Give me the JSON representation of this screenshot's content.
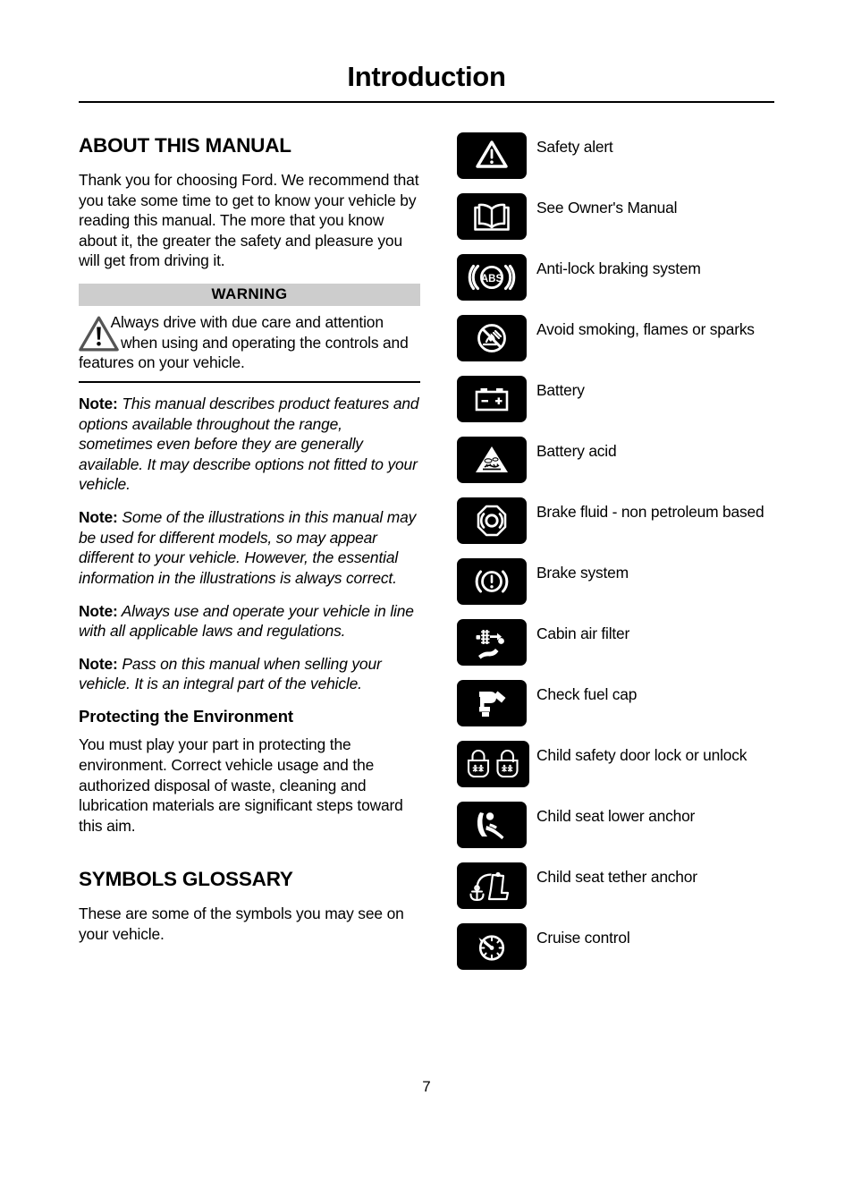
{
  "page": {
    "title": "Introduction",
    "number": "7"
  },
  "left_column": {
    "about": {
      "heading": "ABOUT THIS MANUAL",
      "intro": "Thank you for choosing Ford. We recommend that you take some time to get to know your vehicle by reading this manual. The more that you know about it, the greater the safety and pleasure you will get from driving it.",
      "warning": {
        "bar_label": "WARNING",
        "text": "Always drive with due care and attention when using and operating the controls and features on your vehicle.",
        "icon": "warning-triangle-icon"
      },
      "notes": [
        {
          "label": "Note:",
          "text": " This manual describes product features and options available throughout the range, sometimes even before they are generally available. It may describe options not fitted to your vehicle."
        },
        {
          "label": "Note:",
          "text": " Some of the illustrations in this manual may be used for different models, so may appear different to your vehicle. However, the essential information in the illustrations is always correct."
        },
        {
          "label": "Note:",
          "text": " Always use and operate your vehicle in line with all applicable laws and regulations."
        },
        {
          "label": "Note:",
          "text": " Pass on this manual when selling your vehicle. It is an integral part of the vehicle."
        }
      ]
    },
    "environment": {
      "heading": "Protecting the Environment",
      "text": "You must play your part in protecting the environment. Correct vehicle usage and the authorized disposal of waste, cleaning and lubrication materials are significant steps toward this aim."
    },
    "glossary": {
      "heading": "SYMBOLS GLOSSARY",
      "text": "These are some of the symbols you may see on your vehicle."
    }
  },
  "right_column": {
    "symbols": [
      {
        "icon": "safety-alert-icon",
        "label": "Safety alert"
      },
      {
        "icon": "owners-manual-book-icon",
        "label": "See Owner's Manual"
      },
      {
        "icon": "abs-icon",
        "label": "Anti-lock braking system"
      },
      {
        "icon": "no-smoking-flames-icon",
        "label": "Avoid smoking, flames or sparks"
      },
      {
        "icon": "battery-icon",
        "label": "Battery"
      },
      {
        "icon": "battery-acid-icon",
        "label": "Battery acid"
      },
      {
        "icon": "brake-fluid-icon",
        "label": "Brake fluid - non petroleum based"
      },
      {
        "icon": "brake-system-icon",
        "label": "Brake system"
      },
      {
        "icon": "cabin-air-filter-icon",
        "label": "Cabin air filter"
      },
      {
        "icon": "check-fuel-cap-icon",
        "label": "Check fuel cap"
      },
      {
        "icon": "child-safety-lock-icon",
        "label": "Child safety door lock or unlock"
      },
      {
        "icon": "child-seat-lower-anchor-icon",
        "label": "Child seat lower anchor"
      },
      {
        "icon": "child-seat-tether-anchor-icon",
        "label": "Child seat tether anchor"
      },
      {
        "icon": "cruise-control-icon",
        "label": "Cruise control"
      }
    ]
  },
  "colors": {
    "tile_background": "#000000",
    "tile_glyph": "#ffffff",
    "warning_bar": "#cdcdcd",
    "text": "#000000"
  }
}
